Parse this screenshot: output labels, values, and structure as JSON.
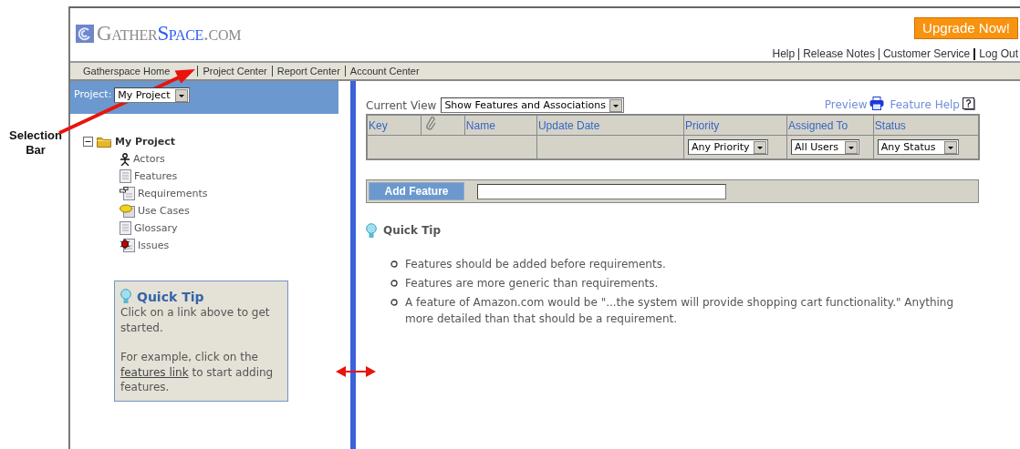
{
  "callout": {
    "label": "Selection Bar"
  },
  "header": {
    "logo": [
      "Gather",
      "Space",
      ".com"
    ],
    "upgrade_button": "Upgrade Now!",
    "links": [
      "Help",
      "Release Notes",
      "Customer Service",
      "Log Out"
    ]
  },
  "nav": [
    "Gatherspace Home",
    "Project Center",
    "Report Center",
    "Account Center"
  ],
  "sidebar": {
    "project_label": "Project:",
    "project_value": "My Project",
    "tree": {
      "label": "My Project",
      "expanded": true,
      "children": [
        {
          "label": "Actors",
          "kind": "actor"
        },
        {
          "label": "Features",
          "kind": "document"
        },
        {
          "label": "Requirements",
          "kind": "requirement"
        },
        {
          "label": "Use Cases",
          "kind": "usecase"
        },
        {
          "label": "Glossary",
          "kind": "document"
        },
        {
          "label": "Issues",
          "kind": "issue"
        }
      ]
    },
    "tip": {
      "title": "Quick Tip",
      "text": "Click on a link above to get started.",
      "example_before": "For example, click on the",
      "link": "features link",
      "example_after": "to start adding features."
    }
  },
  "main": {
    "current_view_label": "Current View",
    "current_view": "Show Features and Associations",
    "links": [
      {
        "label": "Preview",
        "kind": "print"
      },
      {
        "label": "Feature Help",
        "kind": "help"
      }
    ],
    "table": {
      "columns": [
        {
          "label": "Key"
        },
        {
          "kind": "attachment"
        },
        {
          "label": "Name"
        },
        {
          "label": "Update Date"
        },
        {
          "label": "Priority",
          "filter": "Any Priority"
        },
        {
          "label": "Assigned To",
          "filter": "All Users"
        },
        {
          "label": "Status",
          "filter": "Any Status"
        }
      ]
    },
    "add_button": "Add Feature",
    "tip": {
      "title": "Quick Tip",
      "items": [
        "Features should be added before requirements.",
        "Features are more generic than requirements.",
        "A feature of Amazon.com would be \"...the system will provide shopping cart functionality.\" Anything more detailed than that should be a requirement."
      ]
    }
  }
}
